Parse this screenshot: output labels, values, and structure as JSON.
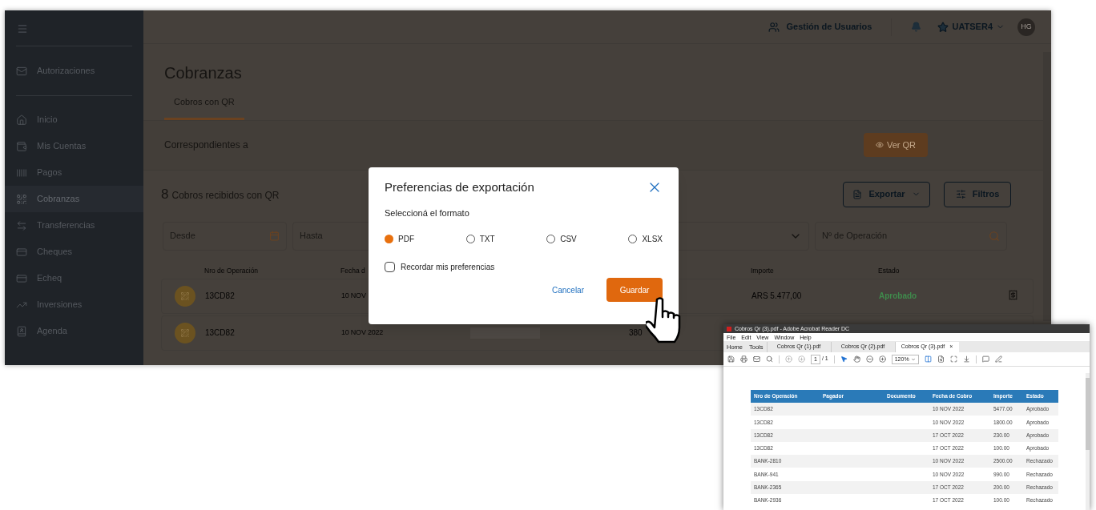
{
  "sidebar": {
    "top_items": [
      {
        "label": "Autorizaciones",
        "selected": false
      }
    ],
    "items": [
      {
        "label": "Inicio",
        "selected": false
      },
      {
        "label": "Mis Cuentas",
        "selected": false
      },
      {
        "label": "Pagos",
        "selected": false
      },
      {
        "label": "Cobranzas",
        "selected": true
      },
      {
        "label": "Transferencias",
        "selected": false
      },
      {
        "label": "Cheques",
        "selected": false
      },
      {
        "label": "Echeq",
        "selected": false
      },
      {
        "label": "Inversiones",
        "selected": false
      },
      {
        "label": "Agenda",
        "selected": false
      }
    ]
  },
  "header": {
    "users_link": "Gestión de Usuarios",
    "account": "UATSER4",
    "avatar": "HG"
  },
  "title": "Cobranzas",
  "tabs": [
    {
      "label": "Cobros con QR",
      "selected": true
    }
  ],
  "period_label": "Correspondientes a",
  "view_qr_button": "Ver QR",
  "count": "8",
  "count_label": "Cobros recibidos con QR",
  "export_button": "Exportar",
  "filters_button": "Filtros",
  "filters": [
    {
      "kind": "date",
      "placeholder": "Desde"
    },
    {
      "kind": "date",
      "placeholder": "Hasta"
    },
    {
      "kind": "select"
    },
    {
      "kind": "search",
      "placeholder": "Nº de Operación"
    }
  ],
  "table": {
    "columns": {
      "operation": "Nro de Operación",
      "date": "Fecha d",
      "amount": "Importe",
      "status": "Estado"
    },
    "rows": [
      {
        "operation": "13CD82",
        "date": "10 NOV",
        "amount": "ARS 5.477,00",
        "status": "Aprobado",
        "receipt": true
      },
      {
        "operation": "13CD82",
        "date": "10 NOV 2022",
        "document": "380"
      }
    ]
  },
  "dialog": {
    "title": "Preferencias de exportación",
    "subtitle": "Seleccioná el formato",
    "formats": [
      {
        "label": "PDF",
        "selected": true
      },
      {
        "label": "TXT",
        "selected": false
      },
      {
        "label": "CSV",
        "selected": false
      },
      {
        "label": "XLSX",
        "selected": false
      }
    ],
    "remember": {
      "label": "Recordar mis preferencias",
      "checked": false
    },
    "cancel": "Cancelar",
    "save": "Guardar"
  },
  "pdf_viewer": {
    "title": "Cobros Qr (3).pdf - Adobe Acrobat Reader DC",
    "menu": [
      "File",
      "Edit",
      "View",
      "Window",
      "Help"
    ],
    "nav": [
      "Home",
      "Tools"
    ],
    "tabs": [
      {
        "label": "Cobros Qr (1).pdf",
        "selected": false
      },
      {
        "label": "Cobros Qr (2).pdf",
        "selected": false
      },
      {
        "label": "Cobros Qr (3).pdf",
        "selected": true
      }
    ],
    "tab_close": "×",
    "page": "1",
    "page_total": "/ 1",
    "zoom": "120%",
    "table": {
      "columns": [
        "Nro de Operación",
        "Pagador",
        "Documento",
        "Fecha de Cobro",
        "Importe",
        "Estado"
      ],
      "rows": [
        {
          "operation": "13CD82",
          "date": "10 NOV 2022",
          "amount": "5477.00",
          "status": "Aprobado"
        },
        {
          "operation": "13CD82",
          "date": "10 NOV 2022",
          "amount": "1800.00",
          "status": "Aprobado"
        },
        {
          "operation": "13CD82",
          "date": "17 OCT 2022",
          "amount": "230.00",
          "status": "Aprobado"
        },
        {
          "operation": "13CD82",
          "date": "17 OCT 2022",
          "amount": "100.00",
          "status": "Aprobado"
        },
        {
          "operation": "BANK-2810",
          "date": "10 NOV 2022",
          "amount": "2500.00",
          "status": "Rechazado"
        },
        {
          "operation": "BANK-941",
          "date": "10 NOV 2022",
          "amount": "990.00",
          "status": "Rechazado"
        },
        {
          "operation": "BANK-2365",
          "date": "17 OCT 2022",
          "amount": "200.00",
          "status": "Rechazado"
        },
        {
          "operation": "BANK-2936",
          "date": "17 OCT 2022",
          "amount": "100.00",
          "status": "Rechazado"
        }
      ]
    }
  }
}
